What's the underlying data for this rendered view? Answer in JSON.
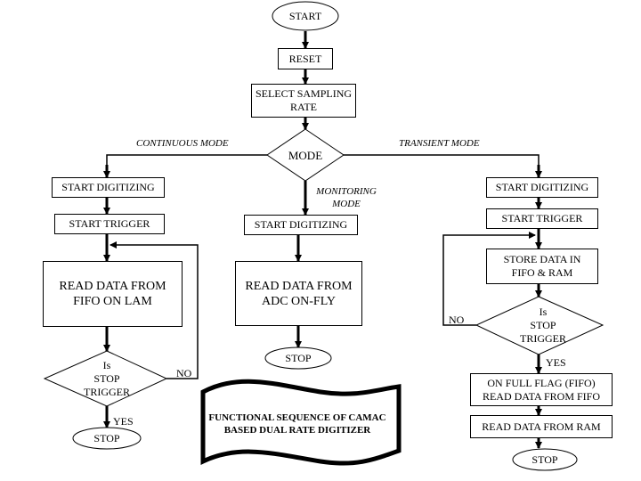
{
  "title": "FUNCTIONAL SEQUENCE OF CAMAC\nBASED DUAL RATE DIGITIZER",
  "main": {
    "start": "START",
    "reset": "RESET",
    "select_rate": "SELECT SAMPLING\nRATE",
    "mode": "MODE"
  },
  "branch_labels": {
    "continuous": "CONTINUOUS MODE",
    "monitoring": "MONITORING\nMODE",
    "transient": "TRANSIENT MODE"
  },
  "continuous": {
    "start_digitizing": "START DIGITIZING",
    "start_trigger": "START TRIGGER",
    "read_data": "READ DATA FROM\nFIFO ON LAM",
    "decision": "Is\nSTOP\nTRIGGER",
    "no": "NO",
    "yes": "YES",
    "stop": "STOP"
  },
  "monitoring": {
    "start_digitizing": "START DIGITIZING",
    "read_data": "READ DATA FROM\nADC ON-FLY",
    "stop": "STOP"
  },
  "transient": {
    "start_digitizing": "START DIGITIZING",
    "start_trigger": "START TRIGGER",
    "store_data": "STORE DATA IN\nFIFO & RAM",
    "decision": "Is\nSTOP\nTRIGGER",
    "no": "NO",
    "yes": "YES",
    "full_flag": "ON FULL FLAG (FIFO)\nREAD DATA FROM FIFO",
    "read_ram": "READ DATA FROM RAM",
    "stop": "STOP"
  }
}
